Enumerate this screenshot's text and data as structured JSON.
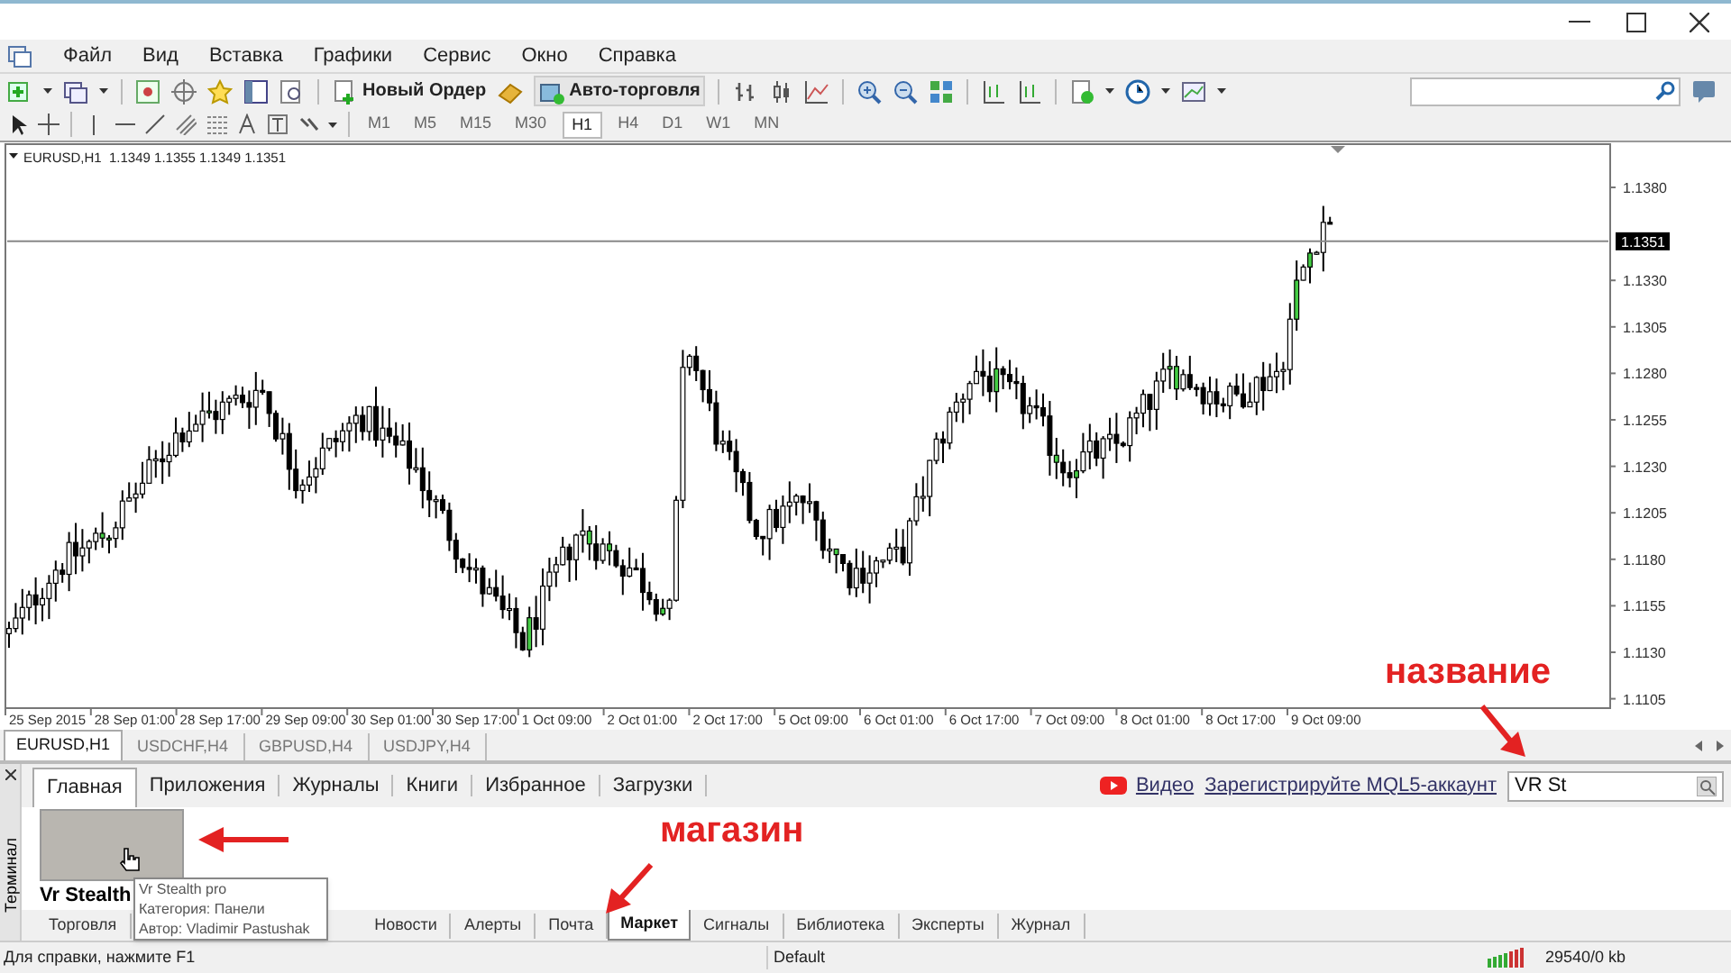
{
  "menu": [
    "Файл",
    "Вид",
    "Вставка",
    "Графики",
    "Сервис",
    "Окно",
    "Справка"
  ],
  "toolbar": {
    "new_order": "Новый Ордер",
    "auto_trading": "Авто-торговля"
  },
  "timeframes": [
    {
      "label": "M1",
      "selected": false
    },
    {
      "label": "M5",
      "selected": false
    },
    {
      "label": "M15",
      "selected": false
    },
    {
      "label": "M30",
      "selected": false
    },
    {
      "label": "H1",
      "selected": true
    },
    {
      "label": "H4",
      "selected": false
    },
    {
      "label": "D1",
      "selected": false
    },
    {
      "label": "W1",
      "selected": false
    },
    {
      "label": "MN",
      "selected": false
    }
  ],
  "chart": {
    "header": "EURUSD,H1  1.1349 1.1355 1.1349 1.1351",
    "current_price": "1.1351",
    "price_labels": [
      "1.1380",
      "1.1330",
      "1.1305",
      "1.1280",
      "1.1255",
      "1.1230",
      "1.1205",
      "1.1180",
      "1.1155",
      "1.1130",
      "1.1105"
    ],
    "time_labels": [
      "25 Sep 2015",
      "28 Sep 01:00",
      "28 Sep 17:00",
      "29 Sep 09:00",
      "30 Sep 01:00",
      "30 Sep 17:00",
      "1 Oct 09:00",
      "2 Oct 01:00",
      "2 Oct 17:00",
      "5 Oct 09:00",
      "6 Oct 01:00",
      "6 Oct 17:00",
      "7 Oct 09:00",
      "8 Oct 01:00",
      "8 Oct 17:00",
      "9 Oct 09:00"
    ]
  },
  "chart_tabs": [
    {
      "label": "EURUSD,H1",
      "selected": true
    },
    {
      "label": "USDCHF,H4",
      "selected": false
    },
    {
      "label": "GBPUSD,H4",
      "selected": false
    },
    {
      "label": "USDJPY,H4",
      "selected": false
    }
  ],
  "terminal": {
    "side_label": "Терминал",
    "tabs": [
      {
        "label": "Главная",
        "selected": true
      },
      {
        "label": "Приложения",
        "selected": false
      },
      {
        "label": "Журналы",
        "selected": false
      },
      {
        "label": "Книги",
        "selected": false
      },
      {
        "label": "Избранное",
        "selected": false
      },
      {
        "label": "Загрузки",
        "selected": false
      }
    ],
    "video_link": "Видео",
    "register_link": "Зарегистрируйте MQL5-аккаунт",
    "search_value": "VR St",
    "product_title": "Vr Stealth",
    "tooltip": [
      "Vr Stealth pro",
      "Категория: Панели",
      "Автор: Vladimir Pastushak"
    ],
    "bottom_tabs": [
      {
        "label": "Торговля",
        "selected": false
      },
      {
        "label": "Новости",
        "selected": false
      },
      {
        "label": "Алерты",
        "selected": false
      },
      {
        "label": "Почта",
        "selected": false
      },
      {
        "label": "Маркет",
        "selected": true
      },
      {
        "label": "Сигналы",
        "selected": false
      },
      {
        "label": "Библиотека",
        "selected": false
      },
      {
        "label": "Эксперты",
        "selected": false
      },
      {
        "label": "Журнал",
        "selected": false
      }
    ]
  },
  "annotations": [
    "название",
    "магазин"
  ],
  "status_bar": {
    "help": "Для справки, нажмите F1",
    "profile": "Default",
    "traffic": "29540/0 kb"
  }
}
